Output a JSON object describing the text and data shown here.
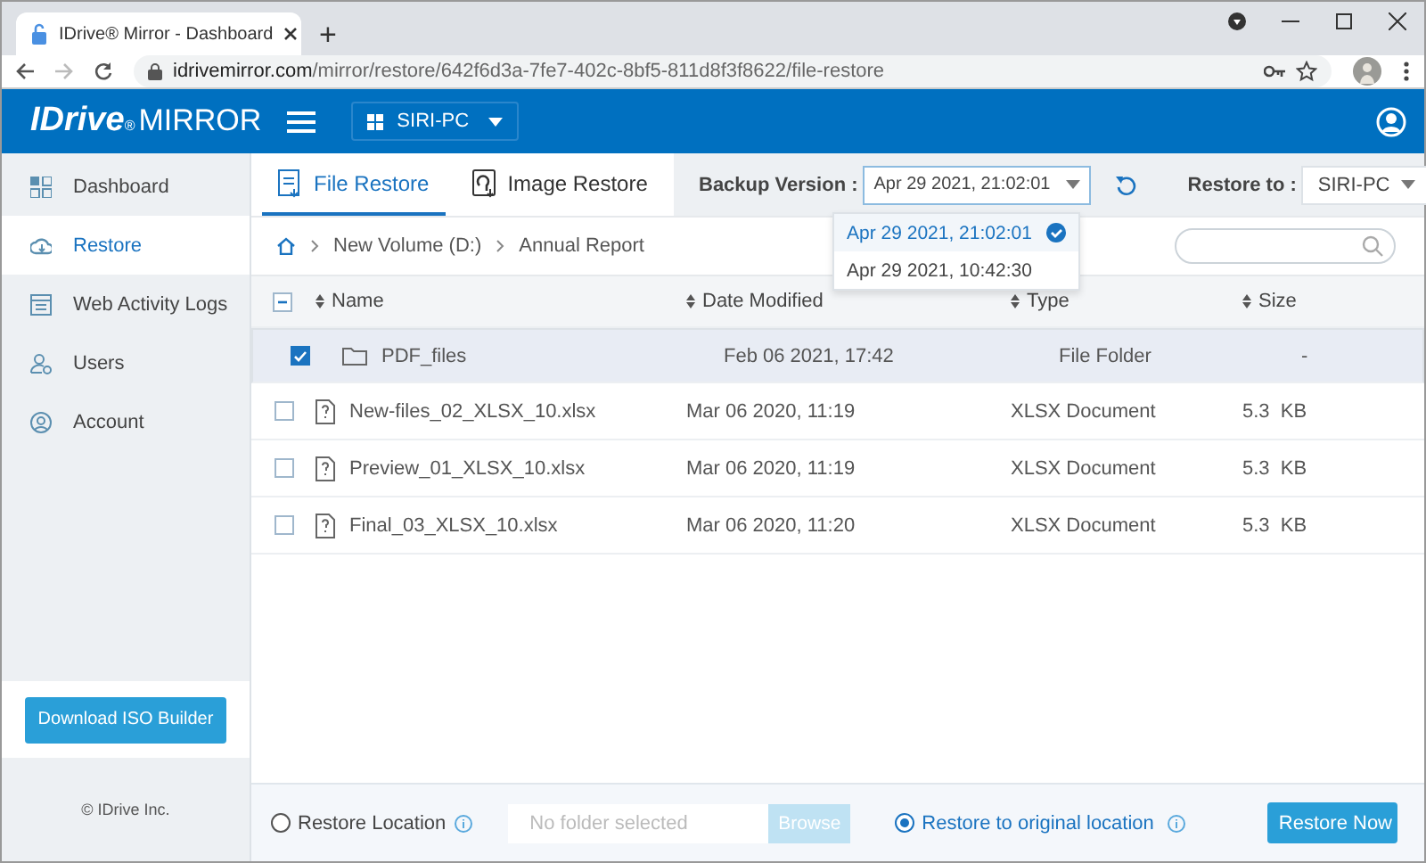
{
  "browser": {
    "tab_title": "IDrive® Mirror - Dashboard",
    "new_tab": "+",
    "url_host": "idrivemirror.com",
    "url_path": "/mirror/restore/642f6d3a-7fe7-402c-8bf5-811d8f3f8622/file-restore"
  },
  "header": {
    "logo": "IDrive",
    "logo_mark": "®",
    "logo_suffix": "MIRROR",
    "computer": "SIRI-PC"
  },
  "sidebar": {
    "items": [
      {
        "label": "Dashboard",
        "selected": false
      },
      {
        "label": "Restore",
        "selected": true
      },
      {
        "label": "Web Activity Logs",
        "selected": false
      },
      {
        "label": "Users",
        "selected": false
      },
      {
        "label": "Account",
        "selected": false
      }
    ],
    "download_button": "Download ISO Builder",
    "copyright": "© IDrive Inc."
  },
  "tabs": [
    {
      "label": "File Restore",
      "selected": true
    },
    {
      "label": "Image Restore",
      "selected": false
    }
  ],
  "backup_version": {
    "label": "Backup Version :",
    "value": "Apr 29 2021, 21:02:01",
    "expanded": true,
    "options": [
      {
        "label": "Apr 29 2021, 21:02:01",
        "selected": true
      },
      {
        "label": "Apr 29 2021, 10:42:30",
        "selected": false
      }
    ]
  },
  "restore_to": {
    "label": "Restore to :",
    "value": "SIRI-PC"
  },
  "breadcrumb": [
    "New Volume (D:)",
    "Annual Report"
  ],
  "table": {
    "select_all_partial": true,
    "columns": [
      "Name",
      "Date Modified",
      "Type",
      "Size"
    ],
    "rows": [
      {
        "kind": "folder",
        "name": "PDF_files",
        "date": "Feb 06 2021, 17:42",
        "type": "File Folder",
        "size": "-",
        "checked": true
      },
      {
        "kind": "file",
        "name": "New-files_02_XLSX_10.xlsx",
        "date": "Mar 06 2020, 11:19",
        "type": "XLSX Document",
        "size": "5.3  KB",
        "checked": false
      },
      {
        "kind": "file",
        "name": "Preview_01_XLSX_10.xlsx",
        "date": "Mar 06 2020, 11:19",
        "type": "XLSX Document",
        "size": "5.3  KB",
        "checked": false
      },
      {
        "kind": "file",
        "name": "Final_03_XLSX_10.xlsx",
        "date": "Mar 06 2020, 11:20",
        "type": "XLSX Document",
        "size": "5.3  KB",
        "checked": false
      }
    ]
  },
  "footer": {
    "options": [
      {
        "label": "Restore Location",
        "selected": false
      },
      {
        "label": "Restore to original location",
        "selected": true
      }
    ],
    "folder_placeholder": "No folder selected",
    "browse": "Browse",
    "restore_button": "Restore Now"
  }
}
